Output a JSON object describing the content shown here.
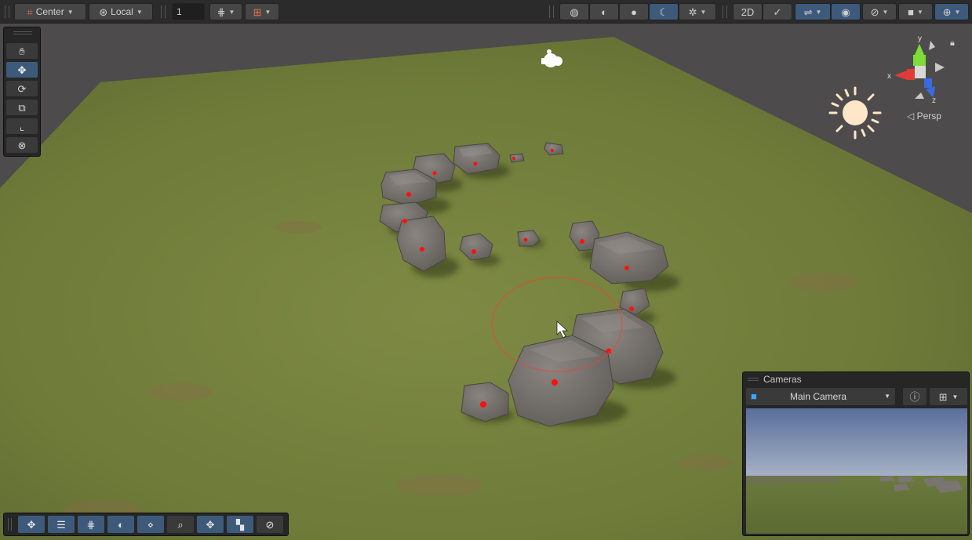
{
  "toolbar": {
    "pivot_label": "Center",
    "space_label": "Local",
    "grid_increment": "1"
  },
  "gizmo": {
    "axis_x": "x",
    "axis_y": "y",
    "axis_z": "z",
    "projection_label": "Persp"
  },
  "tools": [
    "hand-tool",
    "move-tool",
    "rotate-tool",
    "scale-tool",
    "rect-tool",
    "transform-tool"
  ],
  "cameras_overlay": {
    "title": "Cameras",
    "selected_camera": "Main Camera"
  },
  "colors": {
    "accent": "#3d5a7a",
    "toolbar_bg": "#2b2b2b",
    "ground": "#6b7a3a",
    "rock": "#6e6a66",
    "pivot_dot": "#ff1010"
  }
}
